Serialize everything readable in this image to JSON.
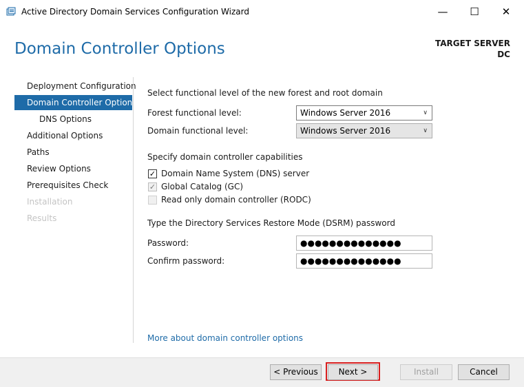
{
  "window": {
    "title": "Active Directory Domain Services Configuration Wizard",
    "controls": {
      "minimize": "—",
      "maximize": "☐",
      "close": "✕"
    }
  },
  "header": {
    "page_title": "Domain Controller Options",
    "target_label": "TARGET SERVER",
    "target_name": "DC"
  },
  "sidebar": {
    "items": [
      {
        "label": "Deployment Configuration",
        "state": "normal"
      },
      {
        "label": "Domain Controller Options",
        "state": "selected"
      },
      {
        "label": "DNS Options",
        "state": "normal"
      },
      {
        "label": "Additional Options",
        "state": "normal"
      },
      {
        "label": "Paths",
        "state": "normal"
      },
      {
        "label": "Review Options",
        "state": "normal"
      },
      {
        "label": "Prerequisites Check",
        "state": "normal"
      },
      {
        "label": "Installation",
        "state": "disabled"
      },
      {
        "label": "Results",
        "state": "disabled"
      }
    ]
  },
  "functional_level": {
    "heading": "Select functional level of the new forest and root domain",
    "forest_label": "Forest functional level:",
    "forest_value": "Windows Server 2016",
    "domain_label": "Domain functional level:",
    "domain_value": "Windows Server 2016"
  },
  "capabilities": {
    "heading": "Specify domain controller capabilities",
    "items": [
      {
        "label": "Domain Name System (DNS) server",
        "checked": true,
        "enabled": true
      },
      {
        "label": "Global Catalog (GC)",
        "checked": true,
        "enabled": false
      },
      {
        "label": "Read only domain controller (RODC)",
        "checked": false,
        "enabled": false
      }
    ]
  },
  "dsrm": {
    "heading": "Type the Directory Services Restore Mode (DSRM) password",
    "password_label": "Password:",
    "password_value": "●●●●●●●●●●●●●●",
    "confirm_label": "Confirm password:",
    "confirm_value": "●●●●●●●●●●●●●●"
  },
  "more_link": "More about domain controller options",
  "footer": {
    "previous": "< Previous",
    "next": "Next >",
    "install": "Install",
    "cancel": "Cancel"
  },
  "colors": {
    "accent": "#1e6ba8",
    "highlight_border": "#d81e1e"
  }
}
